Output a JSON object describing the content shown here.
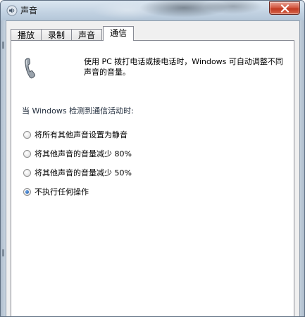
{
  "window": {
    "title": "声音",
    "close_label": "x"
  },
  "tabs": [
    {
      "label": "播放",
      "active": false
    },
    {
      "label": "录制",
      "active": false
    },
    {
      "label": "声音",
      "active": false
    },
    {
      "label": "通信",
      "active": true
    }
  ],
  "panel": {
    "description": "使用 PC 拨打电话或接电话时，Windows 可自动调整不同声音的音量。",
    "prompt": "当 Windows 检测到通信活动时:",
    "options": [
      {
        "label": "将所有其他声音设置为静音",
        "checked": false
      },
      {
        "label": "将其他声音的音量减少 80%",
        "checked": false
      },
      {
        "label": "将其他声音的音量减少 50%",
        "checked": false
      },
      {
        "label": "不执行任何操作",
        "checked": true
      }
    ]
  },
  "icons": {
    "title": "speaker-icon",
    "panel": "telephone-icon",
    "close": "close-icon"
  }
}
